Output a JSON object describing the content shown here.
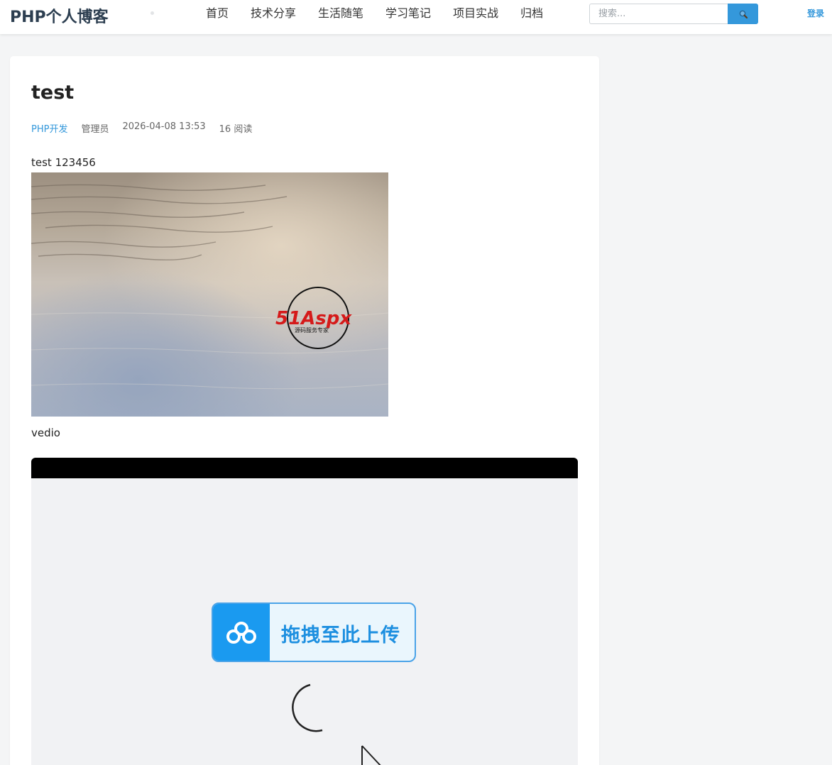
{
  "header": {
    "logo": "PHP个人博客",
    "nav": [
      "首页",
      "技术分享",
      "生活随笔",
      "学习笔记",
      "项目实战",
      "归档"
    ],
    "search_placeholder": "搜索...",
    "login": "登录"
  },
  "article": {
    "title": "test",
    "category": "PHP开发",
    "author": "管理员",
    "datetime": "2026-04-08 13:53",
    "views": "16 阅读",
    "paragraph1": "test 123456",
    "paragraph2": "vedio",
    "watermark_main": "51Aspx",
    "watermark_sub": "源码服务专家",
    "video_upload_label": "拖拽至此上传"
  },
  "colors": {
    "accent": "#3498db",
    "upload_blue": "#1a9af0"
  }
}
